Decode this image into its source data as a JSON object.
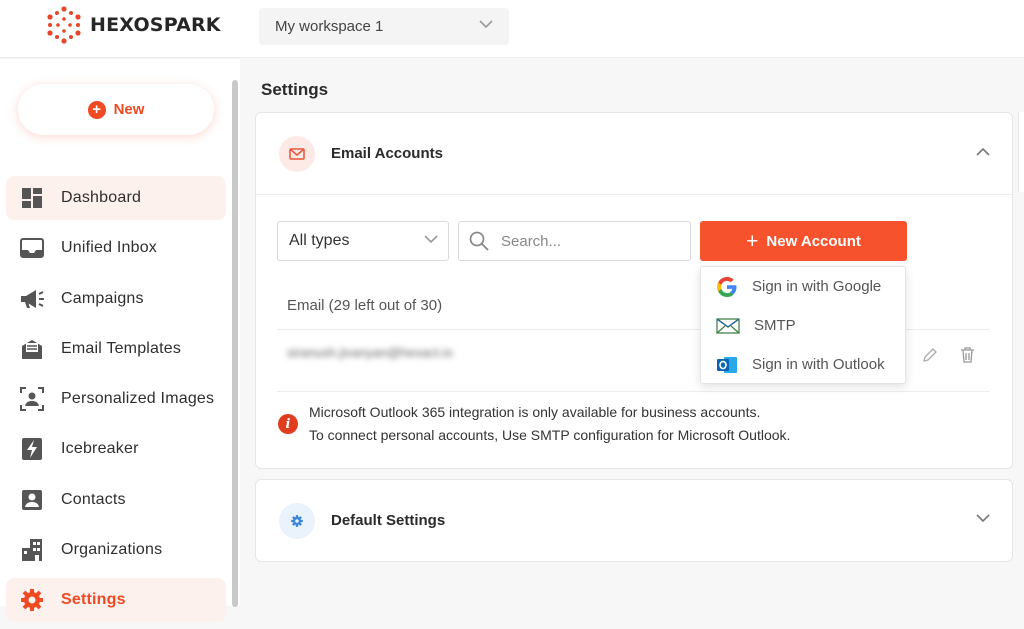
{
  "app": {
    "brand": "HEXOSPARK",
    "workspace": "My workspace 1"
  },
  "sidebar": {
    "new_label": "New",
    "items": [
      {
        "label": "Dashboard",
        "icon": "dashboard-icon"
      },
      {
        "label": "Unified Inbox",
        "icon": "inbox-icon"
      },
      {
        "label": "Campaigns",
        "icon": "megaphone-icon"
      },
      {
        "label": "Email Templates",
        "icon": "envelope-template-icon"
      },
      {
        "label": "Personalized Images",
        "icon": "person-frame-icon"
      },
      {
        "label": "Icebreaker",
        "icon": "lightning-icon"
      },
      {
        "label": "Contacts",
        "icon": "contact-card-icon"
      },
      {
        "label": "Organizations",
        "icon": "building-icon"
      },
      {
        "label": "Settings",
        "icon": "gear-icon"
      }
    ]
  },
  "main": {
    "title": "Settings",
    "email_accounts": {
      "title": "Email Accounts",
      "filter_value": "All types",
      "search_placeholder": "Search...",
      "new_account_label": "New Account",
      "count_label": "Email (29 left out of 30)",
      "account_email": "siranush.jivanyan@hexact.io",
      "info_line1": "Microsoft Outlook 365 integration is only available for business accounts.",
      "info_line2": "To connect personal accounts, Use SMTP configuration for Microsoft Outlook.",
      "menu": [
        {
          "label": "Sign in with Google",
          "icon": "google-icon"
        },
        {
          "label": "SMTP",
          "icon": "smtp-envelope-icon"
        },
        {
          "label": "Sign in with Outlook",
          "icon": "outlook-icon"
        }
      ]
    },
    "default_settings": {
      "title": "Default Settings"
    }
  },
  "colors": {
    "accent": "#f5522d",
    "active_bg": "#fdf1ee"
  }
}
